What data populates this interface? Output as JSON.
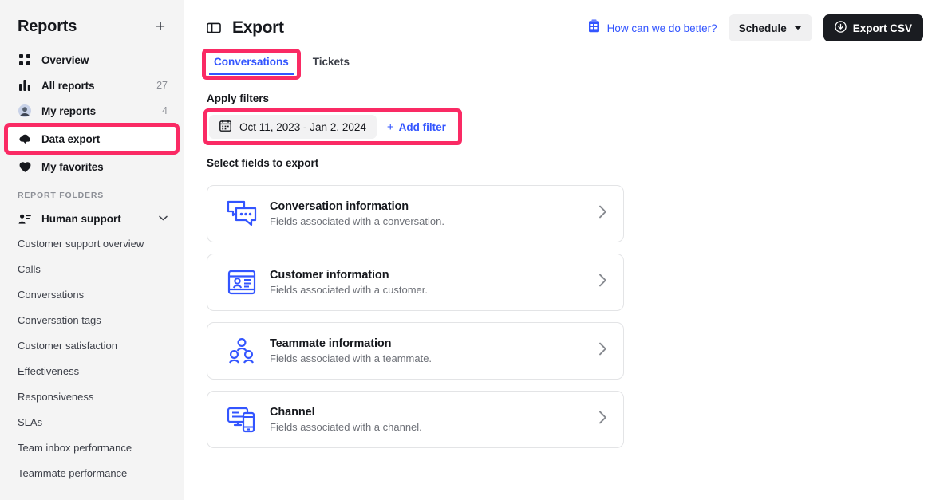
{
  "colors": {
    "accent_blue": "#3355ff",
    "highlight_pink": "#fa2a64",
    "sidebar_bg": "#f4f4f4",
    "dark_button": "#1a1c21",
    "text_primary": "#16181d",
    "text_muted": "#6e7178"
  },
  "sidebar": {
    "title": "Reports",
    "add_label": "+",
    "nav": [
      {
        "label": "Overview",
        "icon": "grid-dots-icon",
        "count": ""
      },
      {
        "label": "All reports",
        "icon": "bar-chart-icon",
        "count": "27"
      },
      {
        "label": "My reports",
        "icon": "avatar-icon",
        "count": "4"
      },
      {
        "label": "Data export",
        "icon": "download-cloud-icon",
        "count": "",
        "highlighted": true
      },
      {
        "label": "My favorites",
        "icon": "heart-icon",
        "count": ""
      }
    ],
    "folders_label": "REPORT FOLDERS",
    "folder": {
      "label": "Human support",
      "icon": "user-card-icon",
      "chevron": "chevron-down-icon"
    },
    "folder_items": [
      "Customer support overview",
      "Calls",
      "Conversations",
      "Conversation tags",
      "Customer satisfaction",
      "Effectiveness",
      "Responsiveness",
      "SLAs",
      "Team inbox performance",
      "Teammate performance"
    ]
  },
  "header": {
    "panel_toggle_icon": "panel-toggle-icon",
    "title": "Export",
    "feedback_label": "How can we do better?",
    "feedback_icon": "clipboard-survey-icon",
    "schedule_label": "Schedule",
    "schedule_caret": "▼",
    "export_label": "Export CSV",
    "export_icon": "download-circle-icon"
  },
  "tabs": [
    {
      "label": "Conversations",
      "active": true,
      "highlighted": true
    },
    {
      "label": "Tickets",
      "active": false,
      "highlighted": false
    }
  ],
  "filters": {
    "section_label": "Apply filters",
    "date_range": "Oct 11, 2023 - Jan 2, 2024",
    "calendar_icon": "calendar-icon",
    "add_filter_label": "Add filter",
    "add_filter_plus": "+"
  },
  "fields": {
    "section_label": "Select fields to export",
    "cards": [
      {
        "title": "Conversation information",
        "desc": "Fields associated with a conversation.",
        "icon": "speech-bubbles-icon",
        "chevron": "chevron-right-icon"
      },
      {
        "title": "Customer information",
        "desc": "Fields associated with a customer.",
        "icon": "id-card-icon",
        "chevron": "chevron-right-icon"
      },
      {
        "title": "Teammate information",
        "desc": "Fields associated with a teammate.",
        "icon": "people-group-icon",
        "chevron": "chevron-right-icon"
      },
      {
        "title": "Channel",
        "desc": "Fields associated with a channel.",
        "icon": "monitor-mobile-icon",
        "chevron": "chevron-right-icon"
      }
    ]
  }
}
